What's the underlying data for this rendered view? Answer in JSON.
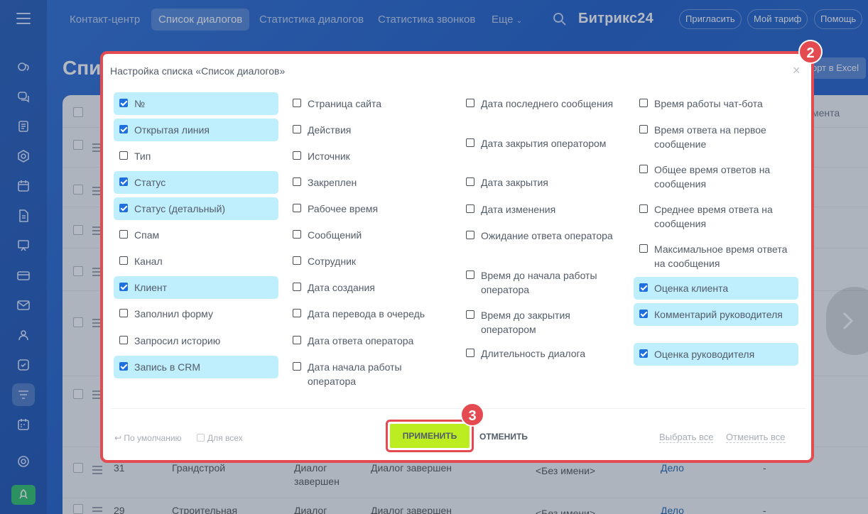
{
  "topbar": {
    "nav": [
      "Контакт-центр",
      "Список диалогов",
      "Статистика диалогов",
      "Статистика звонков",
      "Еще"
    ],
    "logo": "Битрикс24",
    "invite": "Пригласить",
    "tariff": "Мой тариф",
    "help": "Помощь"
  },
  "page": {
    "title_partial": "Спис",
    "excel_partial": "орт в Excel",
    "header_partial": "мента",
    "rows": [
      {
        "num": "31",
        "company": "Грандстрой",
        "type": "Диалог завершен",
        "status": "Диалог завершен",
        "client": "<Без имени>",
        "crm": "Дело",
        "dash": "-"
      },
      {
        "num": "29",
        "company": "Строительная",
        "type": "Диалог",
        "status": "Диалог завершен",
        "client": "<Без имени>",
        "crm": "Дело",
        "dash": "-"
      }
    ]
  },
  "modal": {
    "title": "Настройка списка «Список диалогов»",
    "close": "×",
    "columns": [
      [
        {
          "label": "№",
          "checked": true
        },
        {
          "label": "Открытая линия",
          "checked": true
        },
        {
          "label": "Тип",
          "checked": false
        },
        {
          "label": "Статус",
          "checked": true
        },
        {
          "label": "Статус (детальный)",
          "checked": true
        },
        {
          "label": "Спам",
          "checked": false
        },
        {
          "label": "Канал",
          "checked": false
        },
        {
          "label": "Клиент",
          "checked": true
        },
        {
          "label": "Заполнил форму",
          "checked": false
        },
        {
          "label": "Запросил историю",
          "checked": false
        },
        {
          "label": "Запись в CRM",
          "checked": true
        }
      ],
      [
        {
          "label": "Страница сайта",
          "checked": false
        },
        {
          "label": "Действия",
          "checked": false
        },
        {
          "label": "Источник",
          "checked": false
        },
        {
          "label": "Закреплен",
          "checked": false
        },
        {
          "label": "Рабочее время",
          "checked": false
        },
        {
          "label": "Сообщений",
          "checked": false
        },
        {
          "label": "Сотрудник",
          "checked": false
        },
        {
          "label": "Дата создания",
          "checked": false
        },
        {
          "label": "Дата перевода в очередь",
          "checked": false
        },
        {
          "label": "Дата ответа оператора",
          "checked": false
        },
        {
          "label": "Дата начала работы оператора",
          "checked": false
        }
      ],
      [
        {
          "label": "Дата последнего сообщения",
          "checked": false
        },
        {
          "label": "Дата закрытия оператором",
          "checked": false
        },
        {
          "label": "Дата закрытия",
          "checked": false
        },
        {
          "label": "Дата изменения",
          "checked": false
        },
        {
          "label": "Ожидание ответа оператора",
          "checked": false
        },
        {
          "label": "Время до начала работы оператора",
          "checked": false
        },
        {
          "label": "Время до закрытия оператором",
          "checked": false
        },
        {
          "label": "Длительность диалога",
          "checked": false
        }
      ],
      [
        {
          "label": "Время работы чат-бота",
          "checked": false
        },
        {
          "label": "Время ответа на первое сообщение",
          "checked": false
        },
        {
          "label": "Общее время ответов на сообщения",
          "checked": false
        },
        {
          "label": "Среднее время ответа на сообщения",
          "checked": false
        },
        {
          "label": "Максимальное время ответа на сообщения",
          "checked": false
        },
        {
          "label": "Оценка клиента",
          "checked": true
        },
        {
          "label": "Комментарий руководителя",
          "checked": true
        },
        {
          "label": "Оценка руководителя",
          "checked": true
        }
      ]
    ],
    "footer": {
      "default": "По умолчанию",
      "for_all": "Для всех",
      "apply": "ПРИМЕНИТЬ",
      "cancel": "ОТМЕНИТЬ",
      "select_all": "Выбрать все",
      "deselect_all": "Отменить все"
    }
  },
  "badges": {
    "two": "2",
    "three": "3"
  },
  "colors": {
    "accent_red": "#e34b50",
    "apply_green": "#bbed21",
    "checked_bg": "#bfeefd",
    "checkbox_blue": "#1f6fde"
  }
}
